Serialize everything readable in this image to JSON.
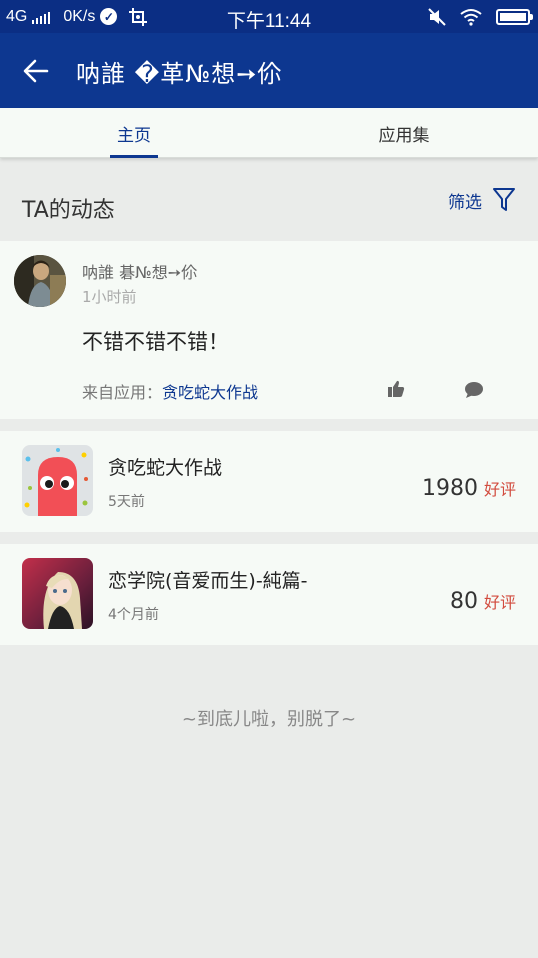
{
  "status_bar": {
    "network": "4G",
    "speed": "0K/s",
    "time": "下午11:44",
    "battery_level": 1.0
  },
  "app_bar": {
    "title": "呐誰 �革№想➙伱"
  },
  "tabs": [
    {
      "label": "主页",
      "active": true
    },
    {
      "label": "应用集",
      "active": false
    }
  ],
  "section": {
    "title": "TA的动态",
    "filter_label": "筛选"
  },
  "post": {
    "user": "呐誰 碁№想➙伱",
    "time": "1小时前",
    "text": "不错不错不错！",
    "source_prefix": "来自应用：",
    "source_app": "贪吃蛇大作战"
  },
  "apps": [
    {
      "name": "贪吃蛇大作战",
      "time": "5天前",
      "score": "1980",
      "score_label": "好评"
    },
    {
      "name": "恋学院(音爱而生)-純篇-",
      "time": "4个月前",
      "score": "80",
      "score_label": "好评"
    }
  ],
  "footer": {
    "text": "~到底儿啦，别脱了~"
  },
  "colors": {
    "primary": "#0d3790",
    "status_bar": "#0b2e84",
    "rating": "#d24b3e",
    "background": "#eaecea",
    "card": "#f6faf6"
  }
}
